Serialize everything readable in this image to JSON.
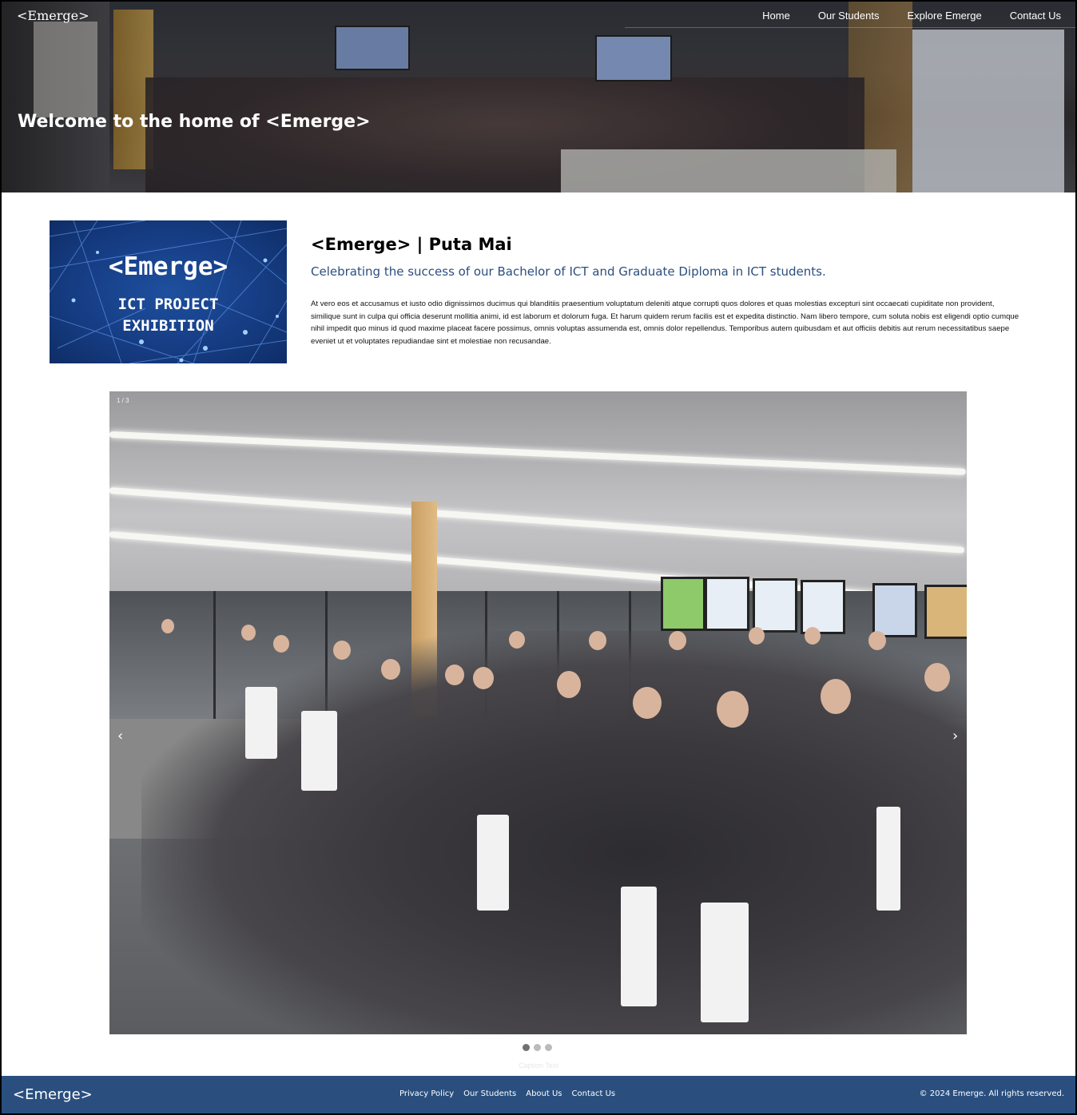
{
  "header": {
    "logo": "<Emerge>",
    "nav": [
      "Home",
      "Our Students",
      "Explore Emerge",
      "Contact Us"
    ],
    "hero_title": "Welcome to the home of <Emerge>"
  },
  "intro": {
    "image_line1": "<Emerge>",
    "image_line2": "ICT PROJECT",
    "image_line3": "EXHIBITION",
    "title": "<Emerge> | Puta Mai",
    "subtitle": "Celebrating the success of our Bachelor of ICT and Graduate Diploma in ICT students.",
    "body": "At vero eos et accusamus et iusto odio dignissimos ducimus qui blanditiis praesentium voluptatum deleniti atque corrupti quos dolores et quas molestias excepturi sint occaecati cupiditate non provident, similique sunt in culpa qui officia deserunt mollitia animi, id est laborum et dolorum fuga. Et harum quidem rerum facilis est et expedita distinctio. Nam libero tempore, cum soluta nobis est eligendi optio cumque nihil impedit quo minus id quod maxime placeat facere possimus, omnis voluptas assumenda est, omnis dolor repellendus. Temporibus autem quibusdam et aut officiis debitis aut rerum necessitatibus saepe eveniet ut et voluptates repudiandae sint et molestiae non recusandae."
  },
  "slideshow": {
    "counter": "1 / 3",
    "prev": "‹",
    "next": "›",
    "caption": "Caption Text",
    "active_index": 0,
    "total": 3
  },
  "footer": {
    "logo": "<Emerge>",
    "links": [
      "Privacy Policy",
      "Our Students",
      "About Us",
      "Contact Us"
    ],
    "copyright": "© 2024 Emerge. All rights reserved."
  },
  "colors": {
    "footer_bg": "#2a4f7f",
    "subtitle": "#2b4f7e",
    "dot_active": "#717171",
    "dot_inactive": "#bbbbbb"
  },
  "icons": [
    "chevron-left-icon",
    "chevron-right-icon"
  ]
}
